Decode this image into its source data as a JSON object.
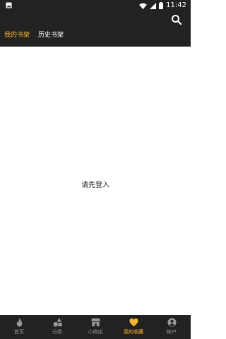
{
  "status_bar": {
    "time": "11:42"
  },
  "header": {
    "tabs": [
      {
        "label": "我的书架",
        "active": true
      },
      {
        "label": "历史书架",
        "active": false
      }
    ]
  },
  "main": {
    "login_prompt": "请先登入"
  },
  "bottom_nav": {
    "items": [
      {
        "label": "首页",
        "icon": "flame-icon",
        "active": false
      },
      {
        "label": "分类",
        "icon": "shapes-icon",
        "active": false
      },
      {
        "label": "小商店",
        "icon": "store-icon",
        "active": false
      },
      {
        "label": "我的收藏",
        "icon": "heart-icon",
        "active": true
      },
      {
        "label": "帐户",
        "icon": "account-icon",
        "active": false
      }
    ]
  },
  "colors": {
    "bar_background": "#222222",
    "accent": "#f5b530",
    "inactive_nav": "#9a9a9a",
    "content_background": "#ffffff"
  }
}
